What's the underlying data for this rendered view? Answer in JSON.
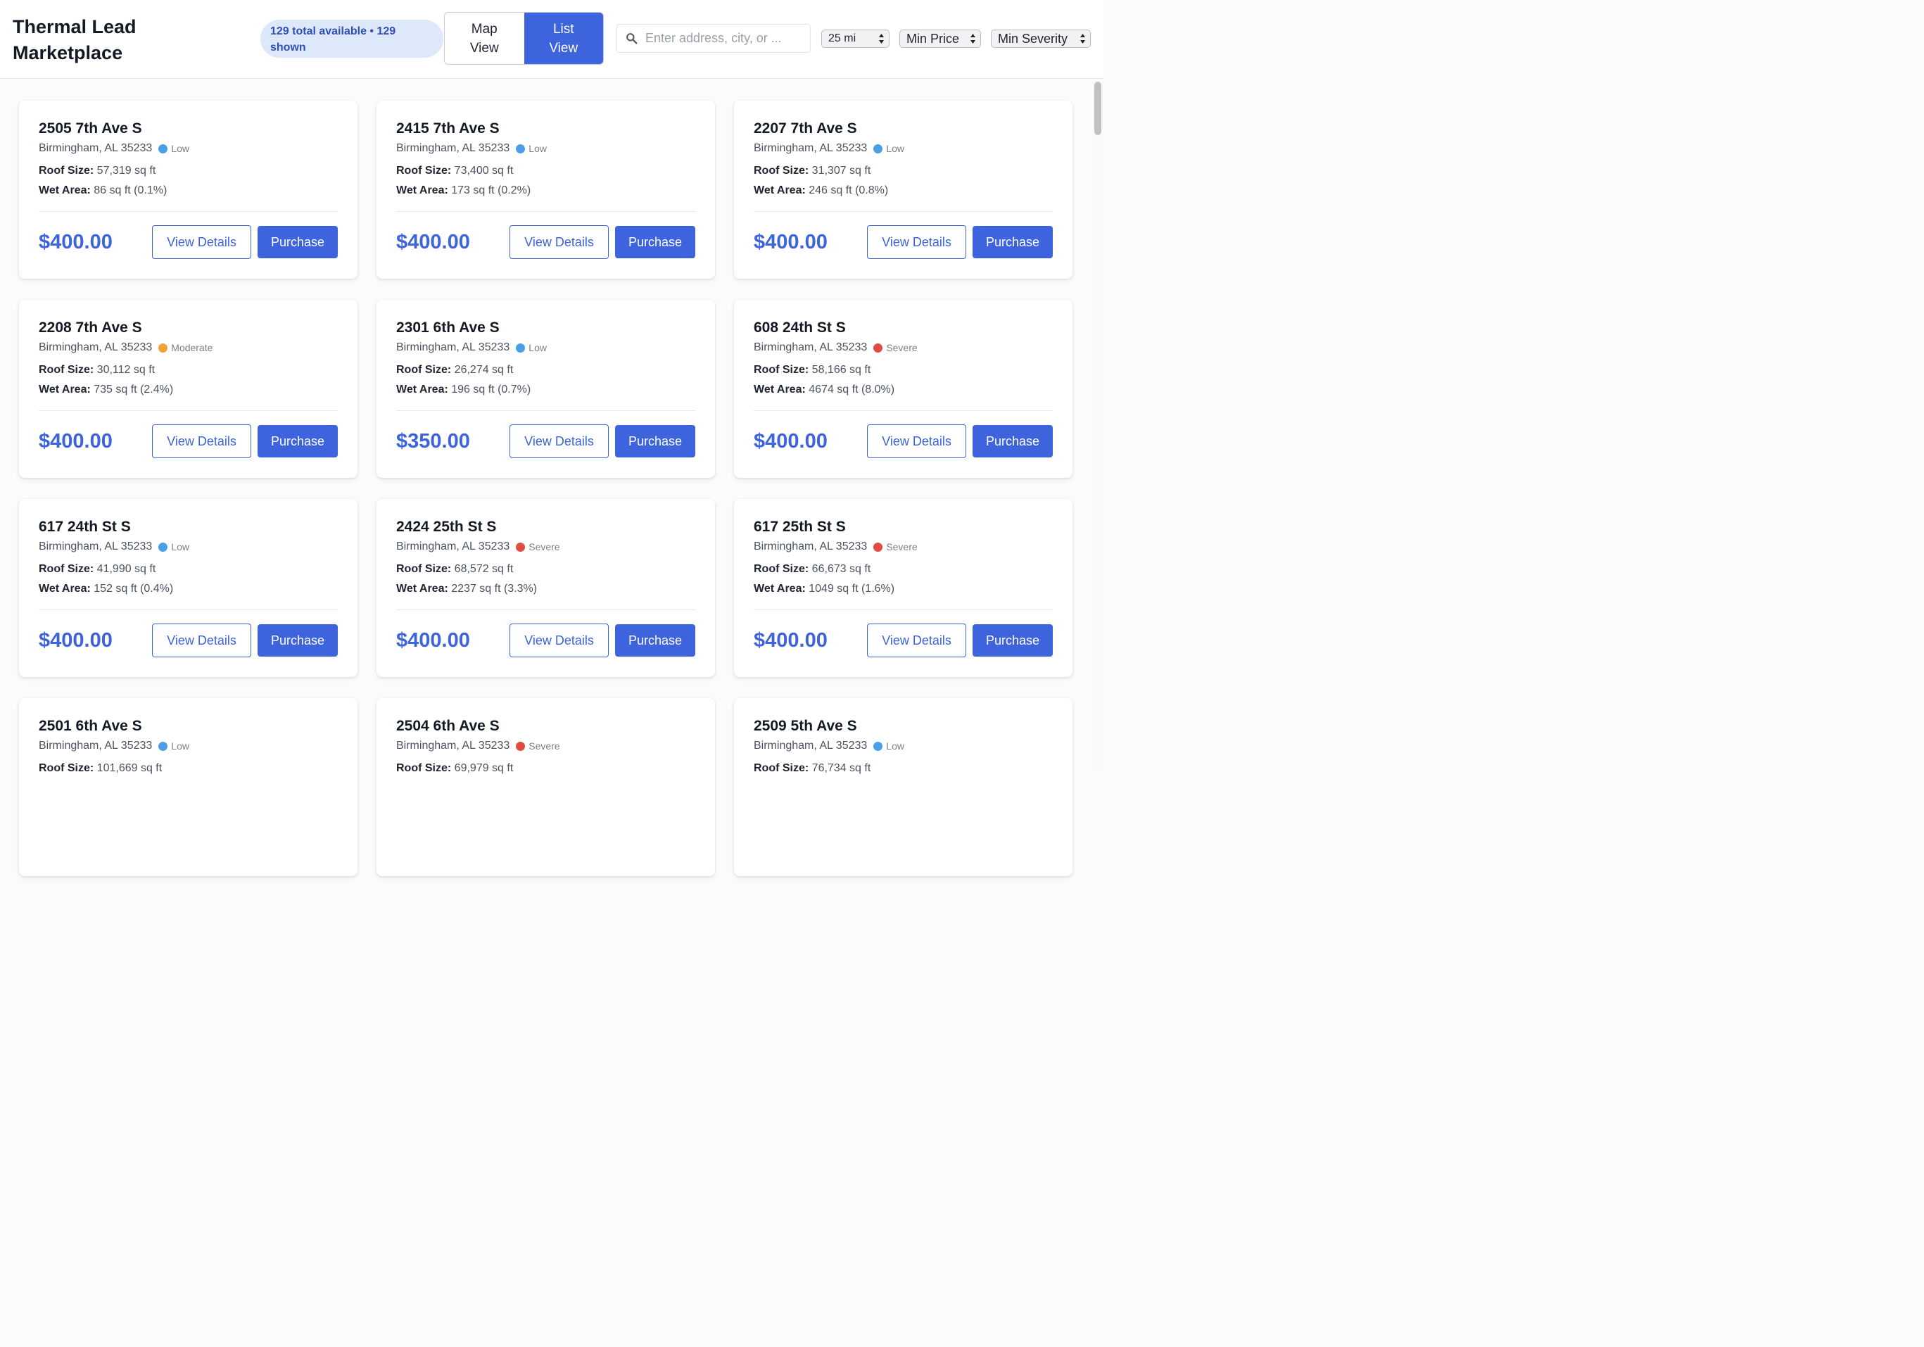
{
  "header": {
    "title": "Thermal Lead Marketplace",
    "count": "129 total available • 129 shown",
    "map_view": "Map View",
    "list_view": "List View",
    "search_placeholder": "Enter address, city, or ...",
    "search_icon": "search-icon",
    "radius": "25 mi",
    "min_price": "Min Price",
    "min_severity": "Min Severity"
  },
  "colors": {
    "accent": "#3d63dd",
    "low": "#4a9fe6",
    "moderate": "#f0a23a",
    "severe": "#e04b43"
  },
  "buttons": {
    "view_details": "View Details",
    "purchase": "Purchase"
  },
  "labels": {
    "roof": "Roof Size:",
    "wet": "Wet Area:"
  },
  "leads": [
    {
      "address": "2505 7th Ave S",
      "city": "Birmingham, AL 35233",
      "severity": "Low",
      "roof": "57,319 sq ft",
      "wet": "86 sq ft (0.1%)",
      "price": "$400.00"
    },
    {
      "address": "2415 7th Ave S",
      "city": "Birmingham, AL 35233",
      "severity": "Low",
      "roof": "73,400 sq ft",
      "wet": "173 sq ft (0.2%)",
      "price": "$400.00"
    },
    {
      "address": "2207 7th Ave S",
      "city": "Birmingham, AL 35233",
      "severity": "Low",
      "roof": "31,307 sq ft",
      "wet": "246 sq ft (0.8%)",
      "price": "$400.00"
    },
    {
      "address": "2208 7th Ave S",
      "city": "Birmingham, AL 35233",
      "severity": "Moderate",
      "roof": "30,112 sq ft",
      "wet": "735 sq ft (2.4%)",
      "price": "$400.00"
    },
    {
      "address": "2301 6th Ave S",
      "city": "Birmingham, AL 35233",
      "severity": "Low",
      "roof": "26,274 sq ft",
      "wet": "196 sq ft (0.7%)",
      "price": "$350.00"
    },
    {
      "address": "608 24th St S",
      "city": "Birmingham, AL 35233",
      "severity": "Severe",
      "roof": "58,166 sq ft",
      "wet": "4674 sq ft (8.0%)",
      "price": "$400.00"
    },
    {
      "address": "617 24th St S",
      "city": "Birmingham, AL 35233",
      "severity": "Low",
      "roof": "41,990 sq ft",
      "wet": "152 sq ft (0.4%)",
      "price": "$400.00"
    },
    {
      "address": "2424 25th St S",
      "city": "Birmingham, AL 35233",
      "severity": "Severe",
      "roof": "68,572 sq ft",
      "wet": "2237 sq ft (3.3%)",
      "price": "$400.00"
    },
    {
      "address": "617 25th St S",
      "city": "Birmingham, AL 35233",
      "severity": "Severe",
      "roof": "66,673 sq ft",
      "wet": "1049 sq ft (1.6%)",
      "price": "$400.00"
    },
    {
      "address": "2501 6th Ave S",
      "city": "Birmingham, AL 35233",
      "severity": "Low",
      "roof": "101,669 sq ft"
    },
    {
      "address": "2504 6th Ave S",
      "city": "Birmingham, AL 35233",
      "severity": "Severe",
      "roof": "69,979 sq ft"
    },
    {
      "address": "2509 5th Ave S",
      "city": "Birmingham, AL 35233",
      "severity": "Low",
      "roof": "76,734 sq ft"
    }
  ]
}
